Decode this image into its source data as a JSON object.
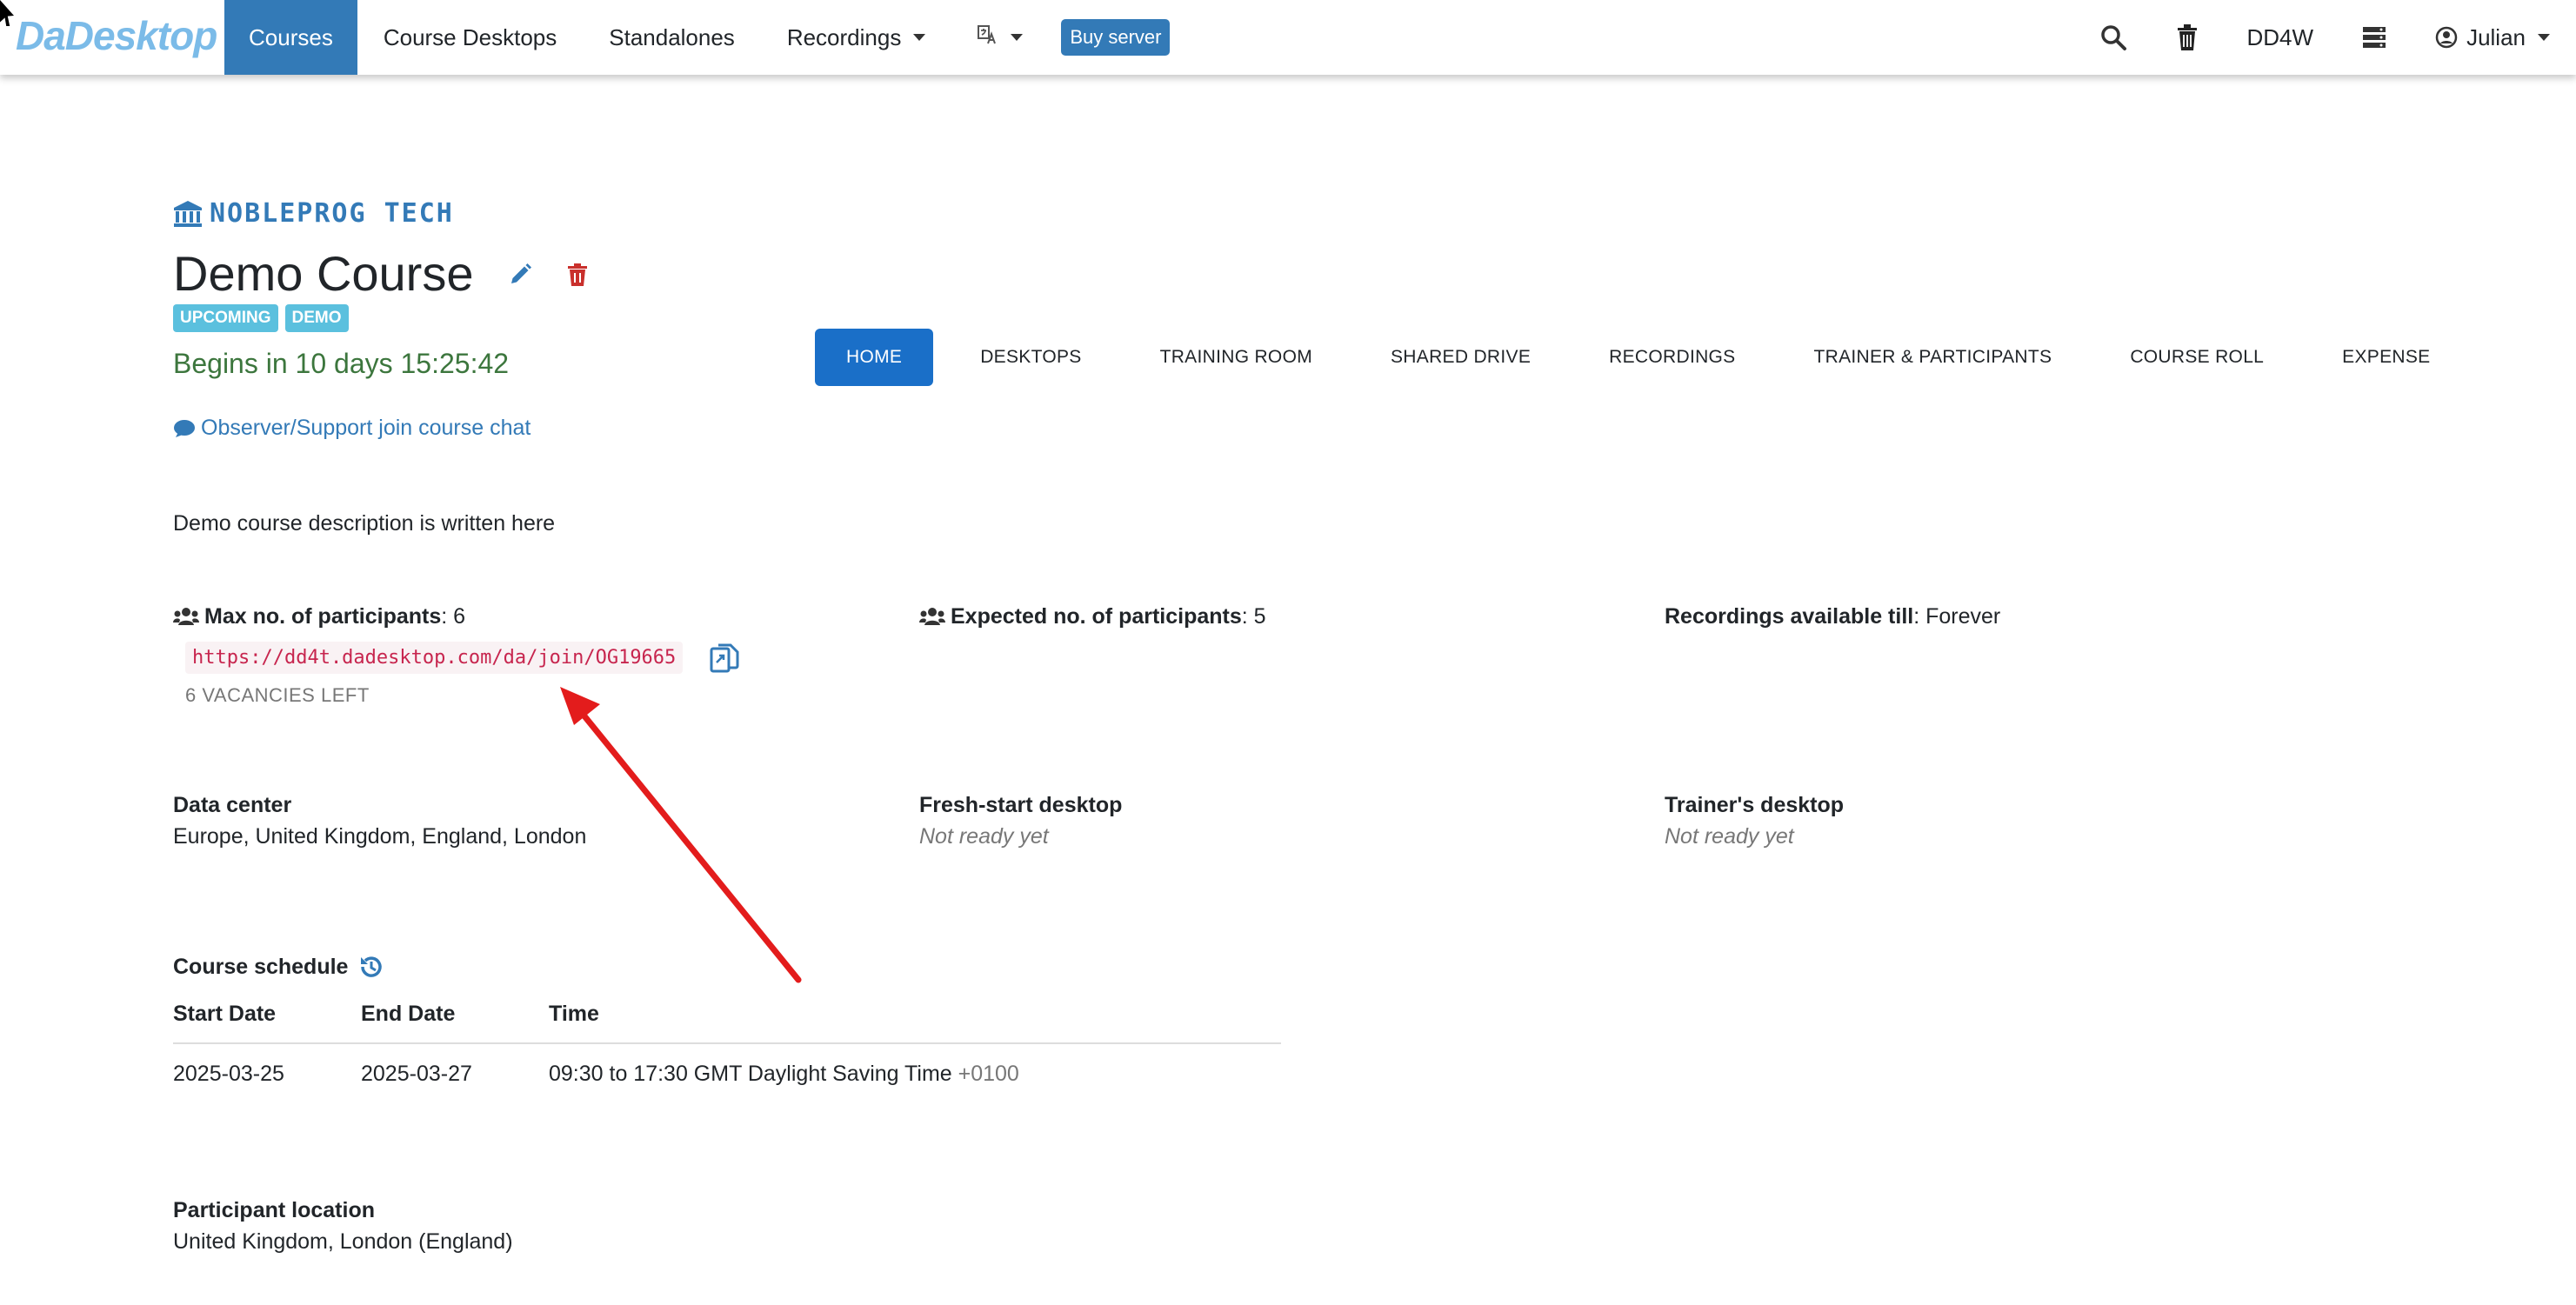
{
  "nav": {
    "brand": "DaDesktop",
    "items": [
      {
        "label": "Courses",
        "active": true
      },
      {
        "label": "Course Desktops"
      },
      {
        "label": "Standalones"
      },
      {
        "label": "Recordings",
        "dropdown": true
      }
    ],
    "language_icon": "translate-icon",
    "buy_server": "Buy server",
    "right": {
      "search_icon": "search-icon",
      "trash_icon": "trash-icon",
      "code": "DD4W",
      "server_icon": "server-icon",
      "user": "Julian"
    }
  },
  "course": {
    "org": "NOBLEPROG TECH",
    "title": "Demo Course",
    "badges": [
      "UPCOMING",
      "DEMO"
    ],
    "countdown": "Begins in 10 days 15:25:42",
    "chat_link": "Observer/Support join course chat",
    "description": "Demo course description is written here"
  },
  "tabs": [
    "HOME",
    "DESKTOPS",
    "TRAINING ROOM",
    "SHARED DRIVE",
    "RECORDINGS",
    "TRAINER & PARTICIPANTS",
    "COURSE ROLL",
    "EXPENSE"
  ],
  "details": {
    "max_participants_label": "Max no. of participants",
    "max_participants_value": ": 6",
    "expected_participants_label": "Expected no. of participants",
    "expected_participants_value": ": 5",
    "recordings_label": "Recordings available till",
    "recordings_value": ": Forever",
    "join_url": "https://dd4t.dadesktop.com/da/join/OG19665",
    "vacancies": "6 VACANCIES LEFT",
    "data_center_label": "Data center",
    "data_center_value": "Europe, United Kingdom, England, London",
    "fresh_start_label": "Fresh-start desktop",
    "fresh_start_value": "Not ready yet",
    "trainer_desktop_label": "Trainer's desktop",
    "trainer_desktop_value": "Not ready yet"
  },
  "schedule": {
    "title": "Course schedule",
    "headers": [
      "Start Date",
      "End Date",
      "Time"
    ],
    "rows": [
      {
        "start": "2025-03-25",
        "end": "2025-03-27",
        "time": "09:30 to 17:30 GMT Daylight Saving Time",
        "offset": "+0100"
      }
    ]
  },
  "location": {
    "label": "Participant location",
    "value": "United Kingdom, London (England)"
  },
  "annotation_color": "#e31c1c",
  "accent_color": "#337ab7"
}
